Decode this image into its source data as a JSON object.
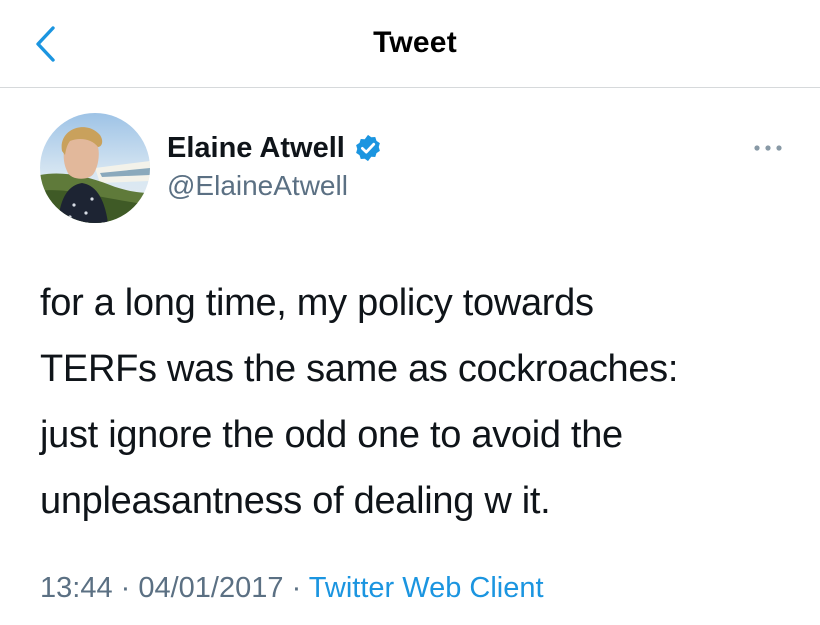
{
  "header": {
    "title": "Tweet",
    "back_icon": "chevron-left-icon"
  },
  "colors": {
    "accent": "#1b95e0",
    "secondary_text": "#5b7083",
    "primary_text": "#0f1419",
    "divider": "#d6d9db"
  },
  "author": {
    "display_name": "Elaine Atwell",
    "handle": "@ElaineAtwell",
    "verified": true,
    "verified_icon": "verified-badge-icon",
    "avatar_icon": "avatar"
  },
  "menu": {
    "more_icon": "more-options-icon"
  },
  "tweet": {
    "lines": [
      "for a long time, my policy towards",
      "TERFs was the same as cockroaches:",
      "just ignore the odd one to avoid the",
      "unpleasantness of dealing w it."
    ],
    "time": "13:44",
    "separator": " · ",
    "date": "04/01/2017",
    "source": "Twitter Web Client"
  }
}
